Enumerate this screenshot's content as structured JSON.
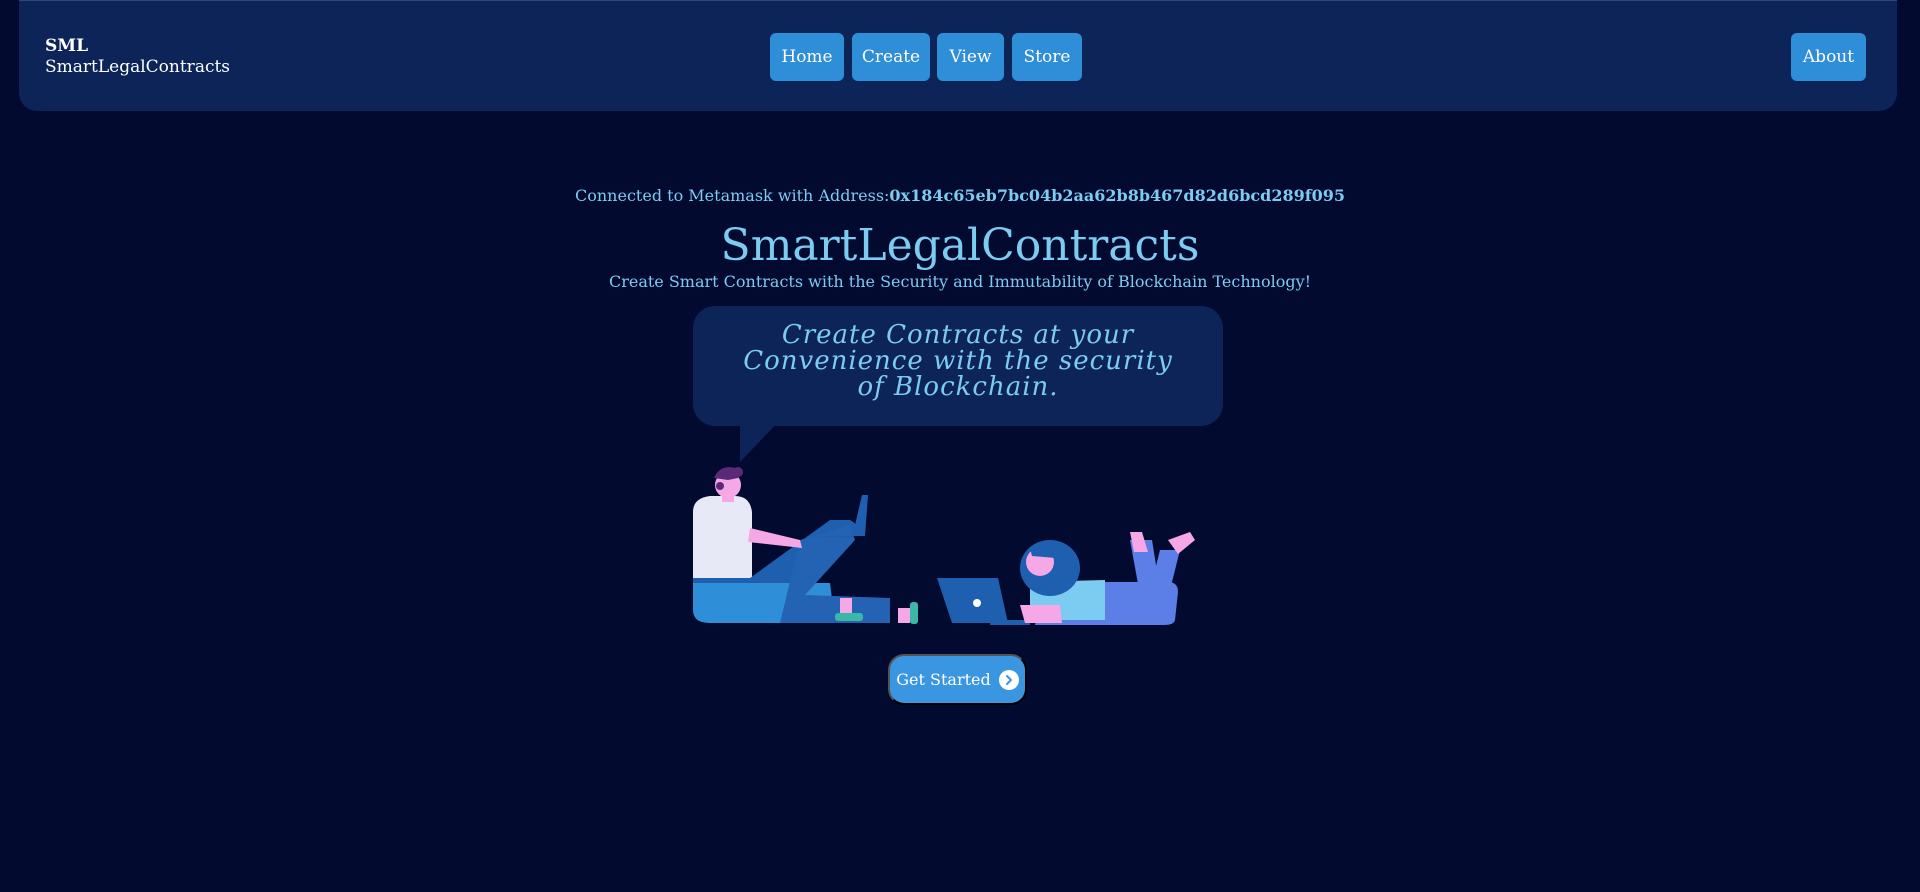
{
  "brand": {
    "short": "SML",
    "full": "SmartLegalContracts"
  },
  "nav": {
    "home": "Home",
    "create": "Create",
    "view": "View",
    "store": "Store",
    "about": "About"
  },
  "connection": {
    "label": "Connected to Metamask with Address:",
    "address": "0x184c65eb7bc04b2aa62b8b467d82d6bcd289f095"
  },
  "hero": {
    "title": "SmartLegalContracts",
    "subtitle": "Create Smart Contracts with the Security and Immutability of Blockchain Technology!",
    "bubble_text": "Create Contracts at your Convenience with the security of Blockchain.",
    "cta_label": "Get Started"
  },
  "colors": {
    "background": "#020a30",
    "navbar": "#0d2459",
    "button": "#2e8ed8",
    "accent_text": "#7ccbf0"
  },
  "icons": {
    "cta": "chevron-right-circle-icon",
    "illustration": "people-with-laptops-illustration"
  }
}
